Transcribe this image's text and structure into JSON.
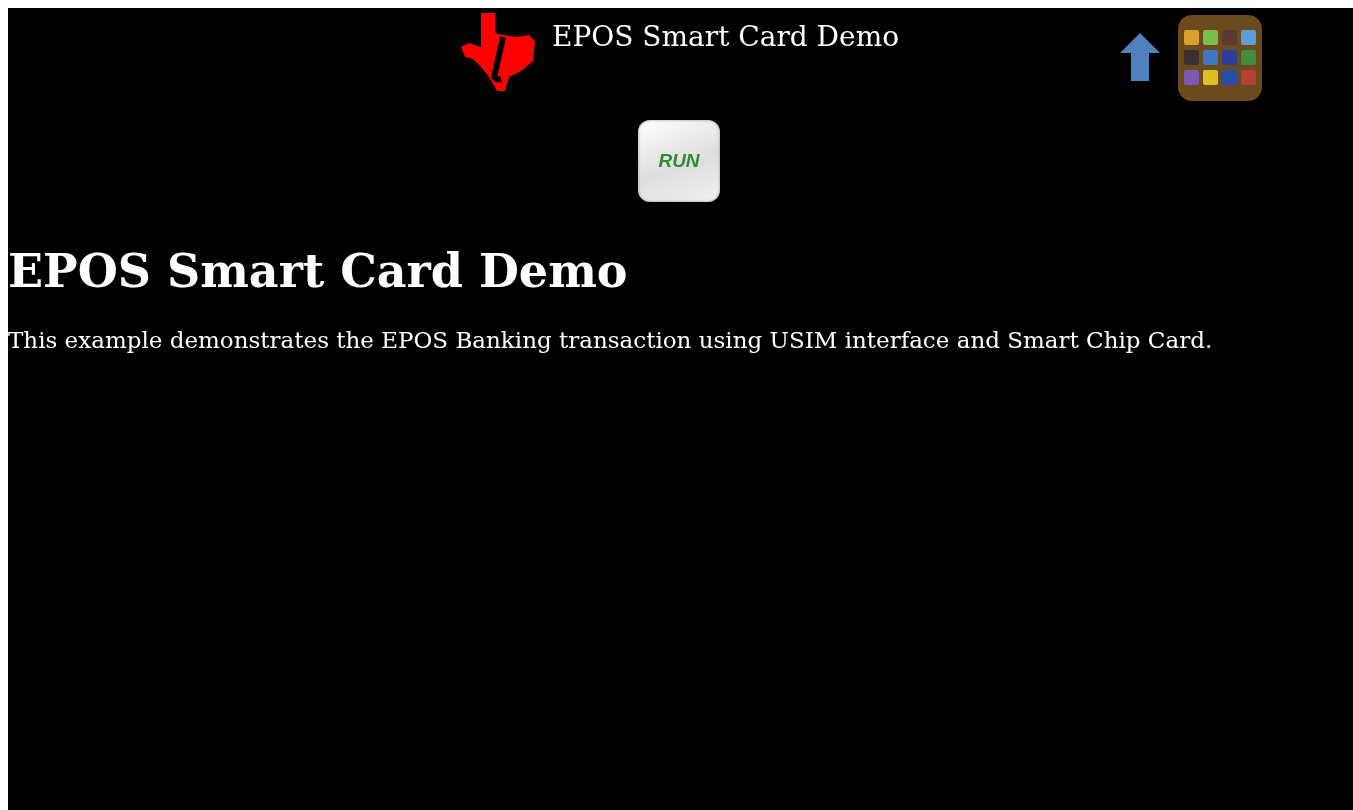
{
  "header": {
    "title": "EPOS Smart Card Demo"
  },
  "run_button": {
    "label": "RUN"
  },
  "content": {
    "heading": "EPOS Smart Card Demo",
    "description": "This example demonstrates the EPOS Banking transaction using USIM interface and Smart Chip Card."
  }
}
